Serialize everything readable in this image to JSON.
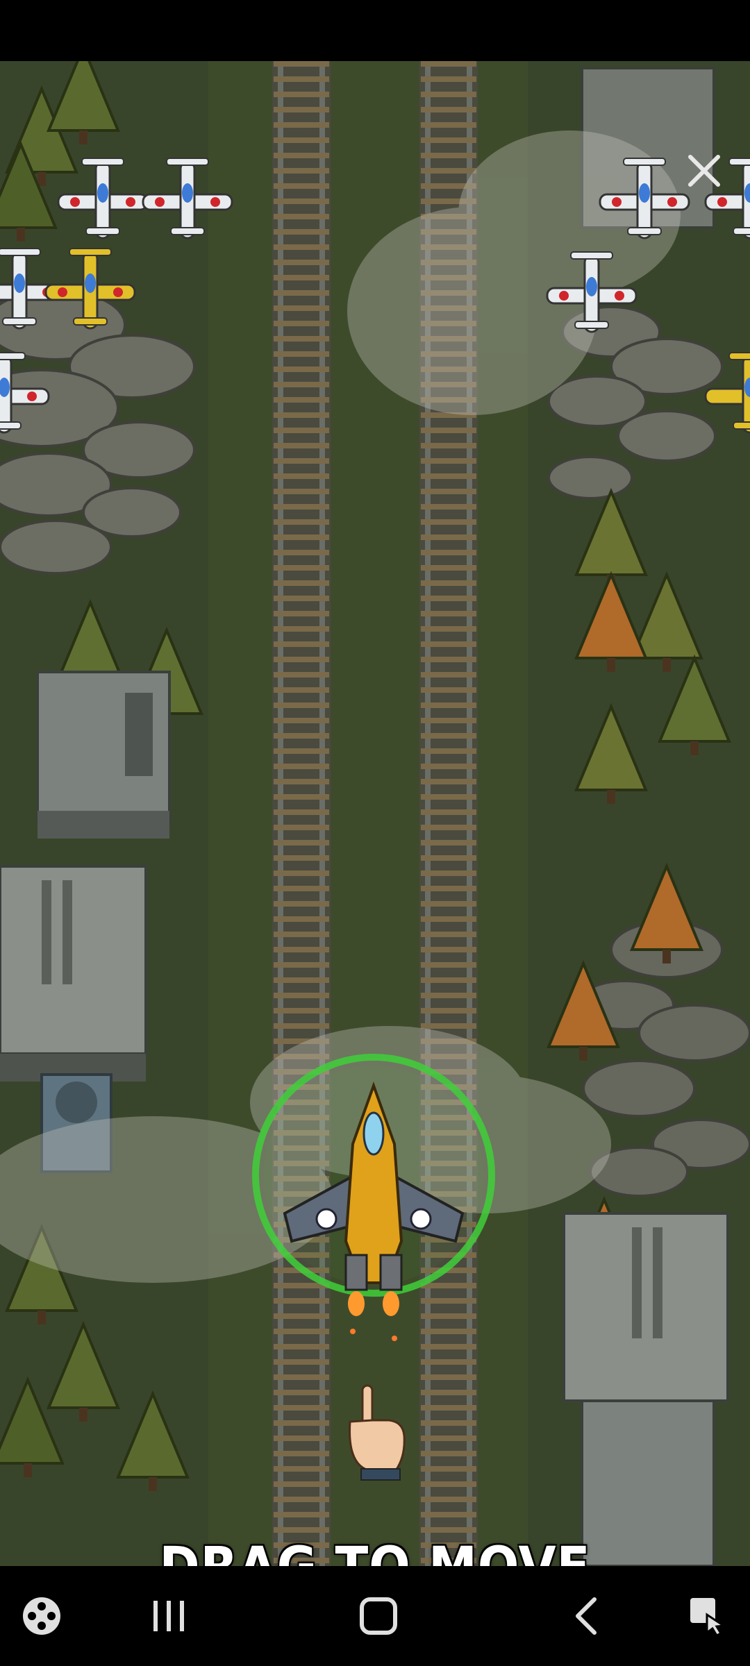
{
  "game": {
    "hint_text": "DRAG TO MOVE",
    "colors": {
      "ground": "#3d4a2a",
      "rail": "#6b6a55",
      "shield": "#3fcf3a",
      "player_gold": "#e0a11b",
      "enemy_white": "#e9ecef",
      "enemy_yellow": "#e1c02a",
      "enemy_roundel": "#d0262b"
    },
    "icons": {
      "close": "close-icon",
      "hand": "pointing-hand-icon",
      "privacy": "hand-shield-icon"
    }
  },
  "navigation": {
    "buttons": [
      {
        "name": "game-launcher",
        "icon": "game-controller-icon"
      },
      {
        "name": "recent-apps",
        "icon": "recent-apps-icon"
      },
      {
        "name": "home",
        "icon": "home-icon"
      },
      {
        "name": "back",
        "icon": "back-icon"
      },
      {
        "name": "screenshot-capture",
        "icon": "touch-capture-icon"
      }
    ]
  }
}
